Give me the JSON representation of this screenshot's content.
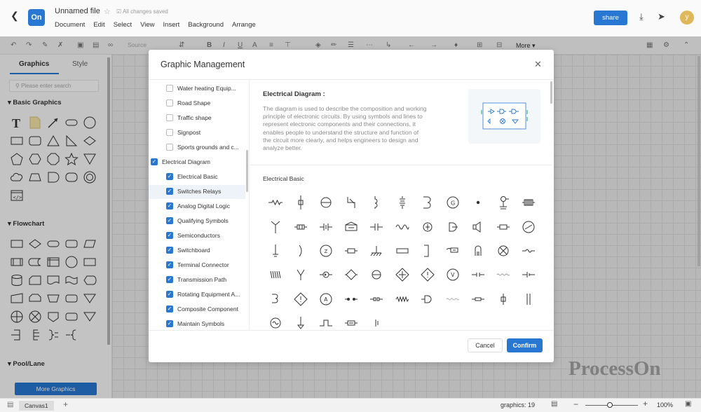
{
  "app": {
    "logo_text": "On",
    "file_name": "Unnamed file",
    "save_status": "All changes saved",
    "share_label": "share",
    "avatar_initial": "y",
    "accent_color": "#2777d3"
  },
  "menus": [
    "Document",
    "Edit",
    "Select",
    "View",
    "Insert",
    "Background",
    "Arrange"
  ],
  "toolbar": {
    "source_label": "Source",
    "more_label": "More"
  },
  "sidebar": {
    "tabs": [
      "Graphics",
      "Style"
    ],
    "search_placeholder": "Please enter search",
    "sections": [
      "Basic Graphics",
      "Flowchart",
      "Pool/Lane"
    ],
    "more_button": "More Graphics"
  },
  "status": {
    "canvas_tab": "Canvas1",
    "graphics_label": "graphics",
    "graphics_count": "19",
    "zoom": "100%"
  },
  "watermark": "ProcessOn",
  "modal": {
    "title": "Graphic Management",
    "categories": [
      {
        "label": "Water heating Equip...",
        "checked": false,
        "level": 1
      },
      {
        "label": "Road Shape",
        "checked": false,
        "level": 1
      },
      {
        "label": "Traffic shape",
        "checked": false,
        "level": 1
      },
      {
        "label": "Signpost",
        "checked": false,
        "level": 1
      },
      {
        "label": "Sports grounds and c...",
        "checked": false,
        "level": 1
      },
      {
        "label": "Electrical Diagram",
        "checked": true,
        "level": 0
      },
      {
        "label": "Electrical Basic",
        "checked": true,
        "level": 1
      },
      {
        "label": "Switches Relays",
        "checked": true,
        "level": 1
      },
      {
        "label": "Analog Digital Logic",
        "checked": true,
        "level": 1
      },
      {
        "label": "Qualifying Symbols",
        "checked": true,
        "level": 1
      },
      {
        "label": "Semiconductors",
        "checked": true,
        "level": 1
      },
      {
        "label": "Switchboard",
        "checked": true,
        "level": 1
      },
      {
        "label": "Terminal Connector",
        "checked": true,
        "level": 1
      },
      {
        "label": "Transmission Path",
        "checked": true,
        "level": 1
      },
      {
        "label": "Rotating Equipment A...",
        "checked": true,
        "level": 1
      },
      {
        "label": "Composite Component",
        "checked": true,
        "level": 1
      },
      {
        "label": "Maintain Symbols",
        "checked": true,
        "level": 1
      }
    ],
    "detail_title": "Electrical Diagram :",
    "detail_desc": "The diagram is used to describe the composition and working principle of electronic circuits. By using symbols and lines to represent electronic components and their connections, it enables people to understand the structure and function of the circuit more clearly, and helps engineers to design and analyze better.",
    "section_label": "Electrical Basic",
    "cancel_label": "Cancel",
    "confirm_label": "Confirm"
  }
}
